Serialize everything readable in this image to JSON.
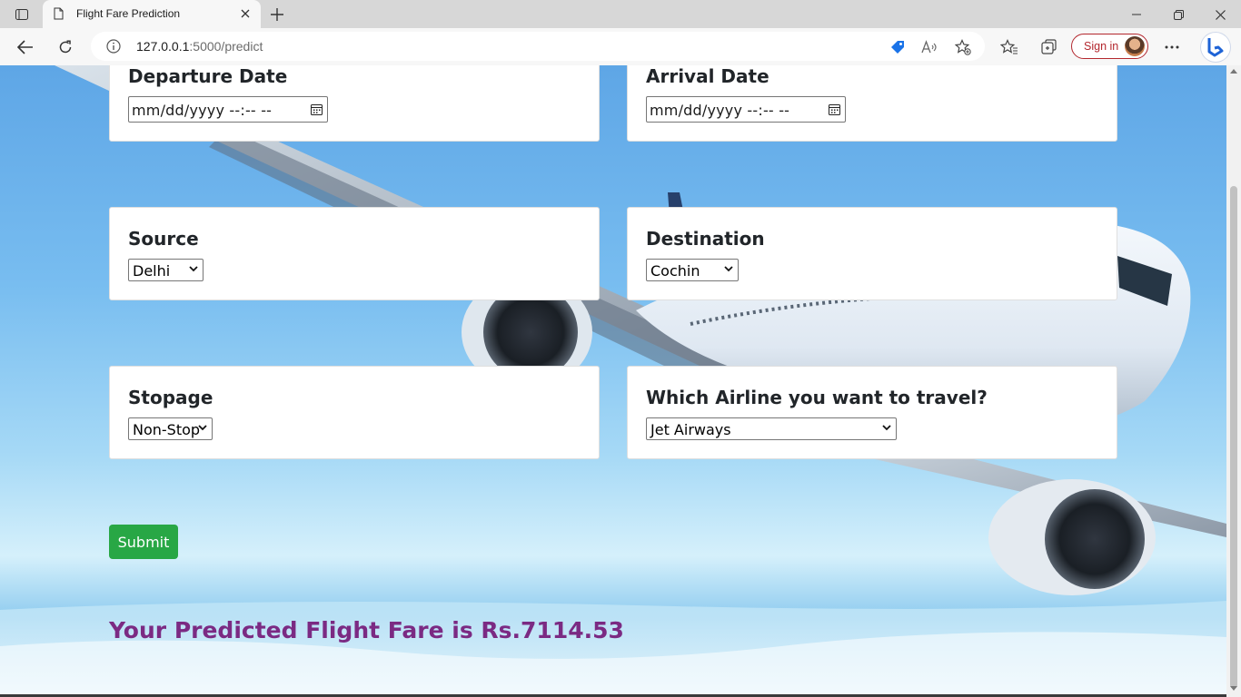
{
  "browser": {
    "tab_title": "Flight Fare Prediction",
    "url_host": "127.0.0.1",
    "url_path": ":5000/predict",
    "sign_in_label": "Sign in"
  },
  "form": {
    "departure": {
      "label": "Departure Date",
      "placeholder": "mm/dd/yyyy  --:-- --"
    },
    "arrival": {
      "label": "Arrival Date",
      "placeholder": "mm/dd/yyyy  --:-- --"
    },
    "source": {
      "label": "Source",
      "selected": "Delhi"
    },
    "destination": {
      "label": "Destination",
      "selected": "Cochin"
    },
    "stopage": {
      "label": "Stopage",
      "selected": "Non-Stop"
    },
    "airline": {
      "label": "Which Airline you want to travel?",
      "selected": "Jet Airways"
    },
    "submit_label": "Submit"
  },
  "result": {
    "text": "Your Predicted Flight Fare is Rs.7114.53"
  },
  "colors": {
    "submit": "#28a745",
    "result": "#7b2a83",
    "sign_in": "#b3272e"
  }
}
